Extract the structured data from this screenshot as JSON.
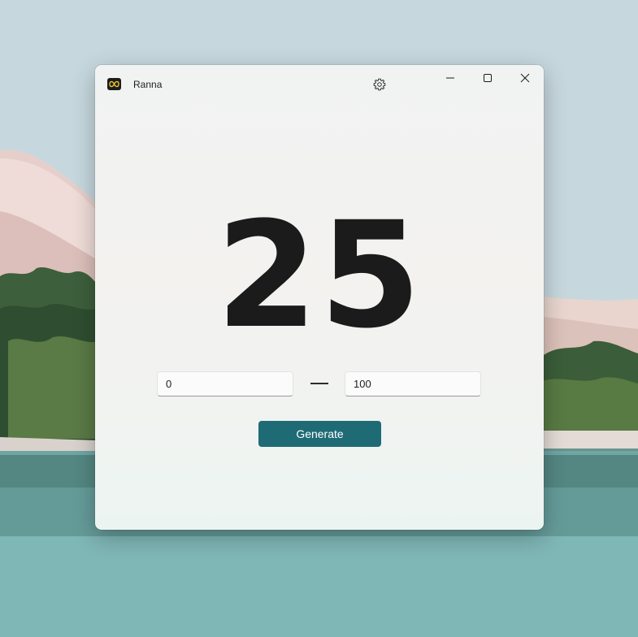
{
  "window": {
    "title": "Ranna",
    "icon": "infinity-icon"
  },
  "titlebar": {
    "settings_icon": "gear-icon",
    "minimize_icon": "minimize-icon",
    "maximize_icon": "maximize-icon",
    "close_icon": "close-icon"
  },
  "result": {
    "value": "25"
  },
  "range": {
    "min_value": "0",
    "max_value": "100",
    "separator": "—"
  },
  "actions": {
    "generate_label": "Generate"
  },
  "colors": {
    "accent": "#1e6b76",
    "icon_accent": "#e8c030",
    "text": "#1b1b1b"
  }
}
